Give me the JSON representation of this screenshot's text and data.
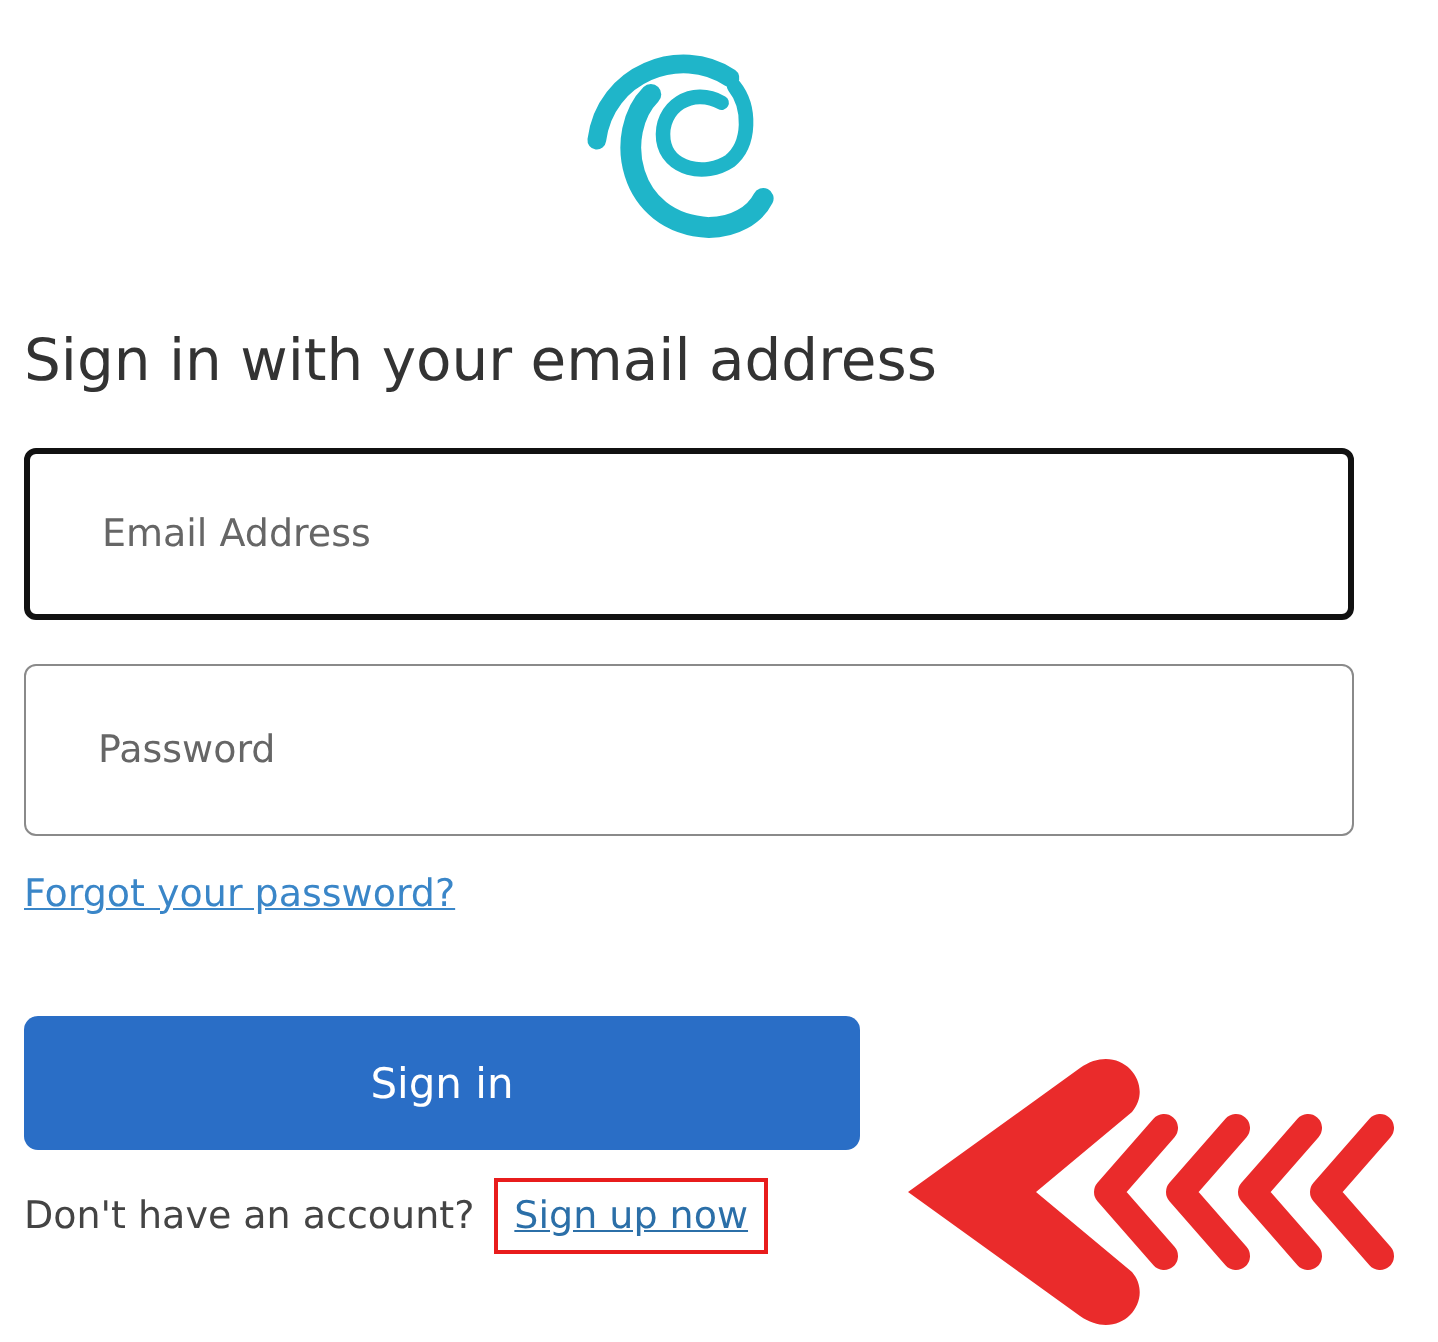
{
  "heading": "Sign in with your email address",
  "fields": [
    {
      "placeholder": "Email Address",
      "focused": true
    },
    {
      "placeholder": "Password",
      "focused": false
    }
  ],
  "forgot_link": "Forgot your password?",
  "sign_in_button": "Sign in",
  "signup_prompt": "Don't have an account?",
  "signup_link": {
    "label": "Sign up now",
    "highlighted": true
  }
}
